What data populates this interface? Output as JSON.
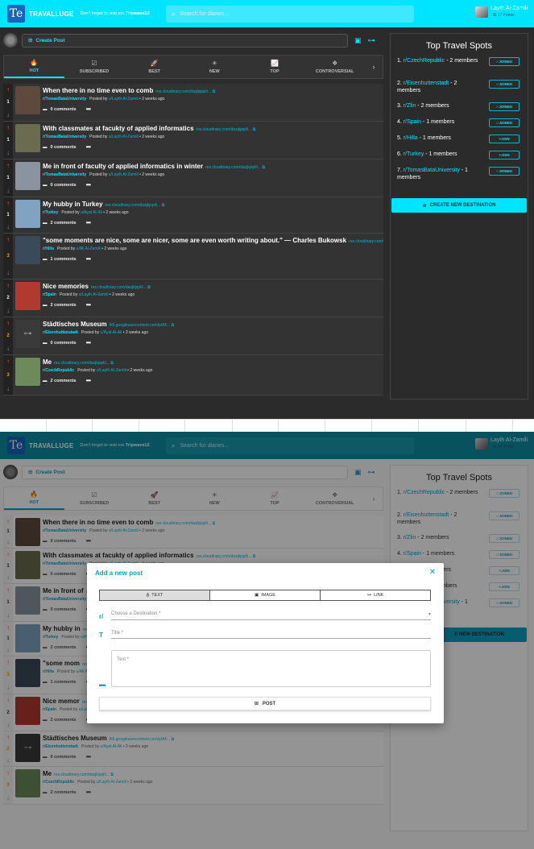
{
  "app": {
    "brand": "TRAVALLUGE",
    "logo_text": "Te",
    "tagline_pre": "Don't forget to visit our",
    "tagline_link": "Tripwave12",
    "search_placeholder": "Search for diaries..."
  },
  "user": {
    "name": "Layth Al-Zamili",
    "points_f1": "17 Points",
    "points_f2": "18 Points"
  },
  "create_post": {
    "label": "Create Post"
  },
  "tabs": [
    {
      "label": "HOT",
      "icon": "fire-icon",
      "glyph": "🔥"
    },
    {
      "label": "SUBSCRIBED",
      "icon": "checkbox-icon",
      "glyph": "☑"
    },
    {
      "label": "BEST",
      "icon": "rocket-icon",
      "glyph": "🚀"
    },
    {
      "label": "NEW",
      "icon": "sun-icon",
      "glyph": "☀"
    },
    {
      "label": "TOP",
      "icon": "chart-icon",
      "glyph": "📈"
    },
    {
      "label": "CONTROVERSIAL",
      "icon": "category-icon",
      "glyph": "❖"
    }
  ],
  "posts": [
    {
      "title": "When there in no time even to comb",
      "link": "res.cloudinary.com/dazjkjxpl/i...",
      "sub": "r/TomasBataUniversity",
      "by": "u/Layth Al-Zamili",
      "time": "2 weeks ago",
      "score": "1",
      "comments": "0 comments",
      "thumb": "#5d4a3c"
    },
    {
      "title": "With classmates at facukty of applied informatics",
      "link": "res.cloudinary.com/dazjkjxpl/i...",
      "sub": "r/TomasBataUniversity",
      "by": "u/Layth Al-Zamili",
      "time": "2 weeks ago",
      "score": "1",
      "comments": "0 comments",
      "thumb": "#6b6b4f"
    },
    {
      "title": "Me in front of faculty of applied informatics in winter",
      "link": "res.cloudinary.com/dazjkjxpl/i...",
      "sub": "r/TomasBataUniversity",
      "by": "u/Layth Al-Zamili",
      "time": "2 weeks ago",
      "score": "1",
      "comments": "0 comments",
      "thumb": "#8a94a0"
    },
    {
      "title": "My hubby in Turkey",
      "link": "res.cloudinary.com/dazjkjxpl/i...",
      "sub": "r/Turkey",
      "by": "u/Ayat Al-Ali",
      "time": "2 weeks ago",
      "score": "1",
      "comments": "2 comments",
      "thumb": "#7fa3c0"
    },
    {
      "title": "\"some moments are nice, some are nicer, some are even worth writing about.\" — Charles Bukowsk",
      "link": "res.cloudinary.com/dazjkjxpl/i...",
      "sub": "r/Hilla",
      "by": "u/Ali Al-Zamili",
      "time": "2 weeks ago",
      "score": "3",
      "comments": "1 comments",
      "thumb": "#3b4a5a"
    },
    {
      "title": "Nice memories",
      "link": "res.cloudinary.com/dazjkjxpl/i...",
      "sub": "r/Spain",
      "by": "u/Layth Al-Zamili",
      "time": "2 weeks ago",
      "score": "2",
      "comments": "2 comments",
      "thumb": "#b03a2e"
    },
    {
      "title": "Städtisches Museum",
      "link": "lh5.googleusercontent.com/p/AF...",
      "sub": "r/Eisenhuttenstadt",
      "by": "u/Ayat Al-Ali",
      "time": "2 weeks ago",
      "score": "2",
      "comments": "0 comments",
      "thumb": "#3a3a3a"
    },
    {
      "title": "Me",
      "link": "res.cloudinary.com/dazjkjxpl/i...",
      "sub": "r/CzechRepublic",
      "by": "u/Layth Al-Zamili",
      "time": "2 weeks ago",
      "score": "3",
      "comments": "2 comments",
      "thumb": "#6c8a5a"
    }
  ],
  "posts_f2_meta": [
    {
      "sub": "r/TomasBataUniversity",
      "by": "u/Layth Al-Zamili"
    },
    {
      "sub": "r/TomasBataUniversity",
      "by": "u/Layth Al-Zamili"
    },
    {
      "sub": "r/TomasBataUniversity",
      "by": "u/Layth Al-Zamili"
    },
    {
      "sub": "r/Turkey",
      "by": "u/Ayat Al-Ali"
    },
    {
      "sub": "r/Hilla",
      "by": "u/Ali Al-Zamili"
    },
    {
      "sub": "r/Spain",
      "by": "u/Layth Al-Zamili"
    },
    {
      "sub": "r/Eisenhuttenstadt",
      "by": "u/Ayat Al-Ali"
    },
    {
      "sub": "r/CzechRepublic",
      "by": "u/Layth Al-Zamili"
    }
  ],
  "posts_f2_titles": [
    "When there in no time even to comb",
    "With classmates at facukty of applied informatics",
    "Me in front of",
    "My hubby in",
    "\"some mom",
    "Nice memor",
    "Städtisches Museum",
    "Me"
  ],
  "sidebar": {
    "title": "Top Travel Spots",
    "spots": [
      {
        "rank": "1.",
        "name": "r/CzechRepublic",
        "members": "- 2 members",
        "joined": true
      },
      {
        "rank": "2.",
        "name": "r/Eisenhuttenstadt",
        "members": "- 2 members",
        "joined": true
      },
      {
        "rank": "3.",
        "name": "r/Zlin",
        "members": "- 2 members",
        "joined": true
      },
      {
        "rank": "4.",
        "name": "r/Spain",
        "members": "- 1 members",
        "joined": true
      },
      {
        "rank": "5.",
        "name": "r/Hilla",
        "members": "- 1 members",
        "joined": false
      },
      {
        "rank": "6.",
        "name": "r/Turkey",
        "members": "- 1 members",
        "joined": false
      },
      {
        "rank": "7.",
        "name": "r/TomasBataUniversity",
        "members": "- 1 members",
        "joined": true
      }
    ],
    "joined_label": "JOINED",
    "join_label": "JOIN",
    "new_destination": "CREATE NEW DESTINATION",
    "new_destination_partial": "E NEW DESTINATION"
  },
  "modal": {
    "title": "Add a new post",
    "tabs": [
      "TEXT",
      "IMAGE",
      "LINK"
    ],
    "destination_label": "Choose a Destination *",
    "title_label": "Title *",
    "text_label": "Text *",
    "post_button": "POST",
    "prefix": "r/",
    "close_glyph": "✕"
  },
  "colors": {
    "accent": "#00e5ff",
    "accent_dark": "#0aa3c2",
    "upvote": "#ff5722"
  }
}
